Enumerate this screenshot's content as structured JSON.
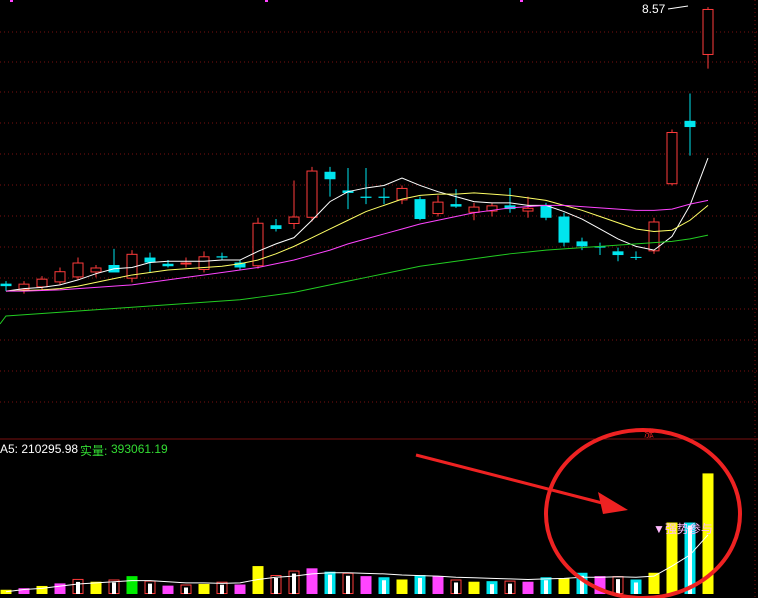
{
  "header": {
    "price_high_label": "8.57",
    "ma5_label": "A5: 210295.98",
    "real_label": "实量:",
    "real_value": "393061.19",
    "signal_label": "▼强势参与"
  },
  "colors": {
    "background": "#000000",
    "up": "#ff3b3b",
    "down": "#00e5ee",
    "ma5": "#ffffff",
    "ma10": "#ffff66",
    "ma20": "#ff44ff",
    "ma60": "#22cc22",
    "vol_ma": "#ffffff",
    "grid": "#7a1010",
    "annotation": "#ee2222",
    "text_white": "#ffffff",
    "text_green": "#33dd33",
    "text_signal": "#ffbbff",
    "vol_yellow": "#ffff00",
    "vol_magenta": "#ff44ff",
    "vol_green": "#00ee00"
  },
  "chart_data": [
    {
      "type": "candlestick",
      "title": "",
      "ylim": [
        3.02,
        8.62
      ],
      "annotations": [
        "8.57"
      ],
      "candles": [
        {
          "o": 4.12,
          "h": 4.16,
          "l": 4.0,
          "c": 4.08,
          "up": false
        },
        {
          "o": 4.02,
          "h": 4.16,
          "l": 3.96,
          "c": 4.12,
          "up": true
        },
        {
          "o": 4.06,
          "h": 4.24,
          "l": 4.02,
          "c": 4.2,
          "up": true
        },
        {
          "o": 4.14,
          "h": 4.38,
          "l": 4.1,
          "c": 4.32,
          "up": true
        },
        {
          "o": 4.22,
          "h": 4.54,
          "l": 4.18,
          "c": 4.46,
          "up": true
        },
        {
          "o": 4.3,
          "h": 4.42,
          "l": 4.22,
          "c": 4.38,
          "up": true
        },
        {
          "o": 4.42,
          "h": 4.68,
          "l": 4.38,
          "c": 4.3,
          "up": false
        },
        {
          "o": 4.2,
          "h": 4.66,
          "l": 4.14,
          "c": 4.6,
          "up": true
        },
        {
          "o": 4.54,
          "h": 4.62,
          "l": 4.3,
          "c": 4.46,
          "up": false
        },
        {
          "o": 4.44,
          "h": 4.5,
          "l": 4.38,
          "c": 4.4,
          "up": false
        },
        {
          "o": 4.44,
          "h": 4.54,
          "l": 4.38,
          "c": 4.46,
          "up": true
        },
        {
          "o": 4.34,
          "h": 4.64,
          "l": 4.3,
          "c": 4.56,
          "up": true
        },
        {
          "o": 4.56,
          "h": 4.62,
          "l": 4.5,
          "c": 4.54,
          "up": false
        },
        {
          "o": 4.46,
          "h": 4.5,
          "l": 4.34,
          "c": 4.38,
          "up": false
        },
        {
          "o": 4.4,
          "h": 5.18,
          "l": 4.36,
          "c": 5.1,
          "up": true
        },
        {
          "o": 5.06,
          "h": 5.16,
          "l": 4.96,
          "c": 5.0,
          "up": false
        },
        {
          "o": 5.08,
          "h": 5.78,
          "l": 5.0,
          "c": 5.2,
          "up": true
        },
        {
          "o": 5.18,
          "h": 6.0,
          "l": 5.12,
          "c": 5.94,
          "up": true
        },
        {
          "o": 5.92,
          "h": 6.0,
          "l": 5.52,
          "c": 5.8,
          "up": false
        },
        {
          "o": 5.62,
          "h": 5.98,
          "l": 5.32,
          "c": 5.58,
          "up": false
        },
        {
          "o": 5.52,
          "h": 5.98,
          "l": 5.4,
          "c": 5.5,
          "up": false
        },
        {
          "o": 5.52,
          "h": 5.66,
          "l": 5.4,
          "c": 5.5,
          "up": false
        },
        {
          "o": 5.46,
          "h": 5.7,
          "l": 5.4,
          "c": 5.66,
          "up": true
        },
        {
          "o": 5.48,
          "h": 5.52,
          "l": 5.14,
          "c": 5.16,
          "up": false
        },
        {
          "o": 5.24,
          "h": 5.54,
          "l": 5.2,
          "c": 5.44,
          "up": true
        },
        {
          "o": 5.4,
          "h": 5.64,
          "l": 5.34,
          "c": 5.36,
          "up": false
        },
        {
          "o": 5.36,
          "h": 5.42,
          "l": 5.14,
          "c": 5.26,
          "up": true
        },
        {
          "o": 5.28,
          "h": 5.42,
          "l": 5.2,
          "c": 5.38,
          "up": true
        },
        {
          "o": 5.38,
          "h": 5.66,
          "l": 5.26,
          "c": 5.32,
          "up": false
        },
        {
          "o": 5.28,
          "h": 5.52,
          "l": 5.18,
          "c": 5.34,
          "up": true
        },
        {
          "o": 5.38,
          "h": 5.42,
          "l": 5.14,
          "c": 5.18,
          "up": false
        },
        {
          "o": 5.2,
          "h": 5.26,
          "l": 4.72,
          "c": 4.78,
          "up": false
        },
        {
          "o": 4.8,
          "h": 4.86,
          "l": 4.66,
          "c": 4.72,
          "up": false
        },
        {
          "o": 4.72,
          "h": 4.78,
          "l": 4.58,
          "c": 4.7,
          "up": false
        },
        {
          "o": 4.64,
          "h": 4.7,
          "l": 4.48,
          "c": 4.58,
          "up": false
        },
        {
          "o": 4.55,
          "h": 4.64,
          "l": 4.5,
          "c": 4.54,
          "up": false
        },
        {
          "o": 4.64,
          "h": 5.18,
          "l": 4.6,
          "c": 5.12,
          "up": true
        },
        {
          "o": 5.72,
          "h": 6.6,
          "l": 5.7,
          "c": 6.56,
          "up": true
        },
        {
          "o": 6.74,
          "h": 7.18,
          "l": 6.18,
          "c": 6.64,
          "up": false
        },
        {
          "o": 7.8,
          "h": 8.57,
          "l": 7.58,
          "c": 8.54,
          "up": true
        }
      ],
      "ma_lines": [
        {
          "name": "MA5",
          "values": [
            4.0,
            4.04,
            4.06,
            4.1,
            4.18,
            4.28,
            4.36,
            4.38,
            4.46,
            4.48,
            4.48,
            4.48,
            4.5,
            4.5,
            4.64,
            4.76,
            4.86,
            5.14,
            5.44,
            5.6,
            5.66,
            5.7,
            5.82,
            5.7,
            5.6,
            5.52,
            5.44,
            5.42,
            5.42,
            5.38,
            5.38,
            5.28,
            5.16,
            5.0,
            4.84,
            4.72,
            4.66,
            4.88,
            5.38,
            6.14
          ]
        },
        {
          "name": "MA10",
          "values": [
            4.0,
            4.01,
            4.02,
            4.04,
            4.08,
            4.14,
            4.2,
            4.26,
            4.3,
            4.34,
            4.36,
            4.38,
            4.4,
            4.44,
            4.5,
            4.6,
            4.72,
            4.86,
            5.0,
            5.14,
            5.28,
            5.38,
            5.48,
            5.54,
            5.56,
            5.56,
            5.58,
            5.56,
            5.54,
            5.5,
            5.46,
            5.38,
            5.3,
            5.2,
            5.1,
            5.0,
            4.96,
            4.98,
            5.14,
            5.38
          ]
        },
        {
          "name": "MA20",
          "values": [
            4.0,
            4.0,
            4.01,
            4.02,
            4.04,
            4.06,
            4.08,
            4.1,
            4.14,
            4.18,
            4.22,
            4.26,
            4.3,
            4.34,
            4.38,
            4.44,
            4.5,
            4.58,
            4.66,
            4.76,
            4.84,
            4.92,
            5.0,
            5.08,
            5.14,
            5.2,
            5.26,
            5.3,
            5.34,
            5.36,
            5.38,
            5.38,
            5.36,
            5.34,
            5.32,
            5.3,
            5.3,
            5.32,
            5.4,
            5.46
          ]
        },
        {
          "name": "MA60",
          "values": [
            3.6,
            3.62,
            3.64,
            3.66,
            3.68,
            3.7,
            3.72,
            3.74,
            3.76,
            3.78,
            3.8,
            3.82,
            3.84,
            3.86,
            3.9,
            3.94,
            3.98,
            4.04,
            4.1,
            4.16,
            4.22,
            4.28,
            4.34,
            4.4,
            4.44,
            4.48,
            4.52,
            4.56,
            4.6,
            4.63,
            4.66,
            4.68,
            4.7,
            4.72,
            4.74,
            4.76,
            4.78,
            4.8,
            4.84,
            4.9
          ]
        }
      ]
    },
    {
      "type": "bar",
      "title": "",
      "ylim": [
        0,
        1200000
      ],
      "legend": [
        "A5: 210295.98",
        "实量: 393061.19"
      ],
      "annotations": [
        "▼强势参与"
      ],
      "values": [
        38000,
        52000,
        72000,
        95000,
        135000,
        110000,
        130000,
        160000,
        120000,
        75000,
        85000,
        90000,
        110000,
        85000,
        250000,
        170000,
        210000,
        230000,
        200000,
        190000,
        160000,
        150000,
        130000,
        170000,
        160000,
        130000,
        110000,
        115000,
        120000,
        110000,
        150000,
        140000,
        190000,
        160000,
        160000,
        130000,
        190000,
        640000,
        640000,
        1080000
      ],
      "color_groups": [
        "yellow",
        "magenta",
        "yellow",
        "magenta",
        "up",
        "yellow",
        "up",
        "green",
        "up",
        "magenta",
        "up",
        "yellow",
        "up",
        "magenta",
        "yellow",
        "up",
        "up",
        "magenta",
        "down",
        "up",
        "magenta",
        "down",
        "yellow",
        "down",
        "magenta",
        "up",
        "yellow",
        "down",
        "up",
        "magenta",
        "down",
        "yellow",
        "down",
        "magenta",
        "up",
        "down",
        "yellow",
        "yellow",
        "down",
        "yellow"
      ],
      "series": [
        {
          "values": [
            20000,
            40000,
            50000,
            70000,
            90000,
            100000,
            110000,
            120000,
            120000,
            110000,
            100000,
            100000,
            95000,
            100000,
            130000,
            150000,
            160000,
            180000,
            190000,
            190000,
            185000,
            180000,
            170000,
            165000,
            160000,
            150000,
            145000,
            140000,
            135000,
            130000,
            135000,
            140000,
            150000,
            150000,
            155000,
            150000,
            160000,
            250000,
            350000,
            530000
          ]
        }
      ]
    }
  ]
}
